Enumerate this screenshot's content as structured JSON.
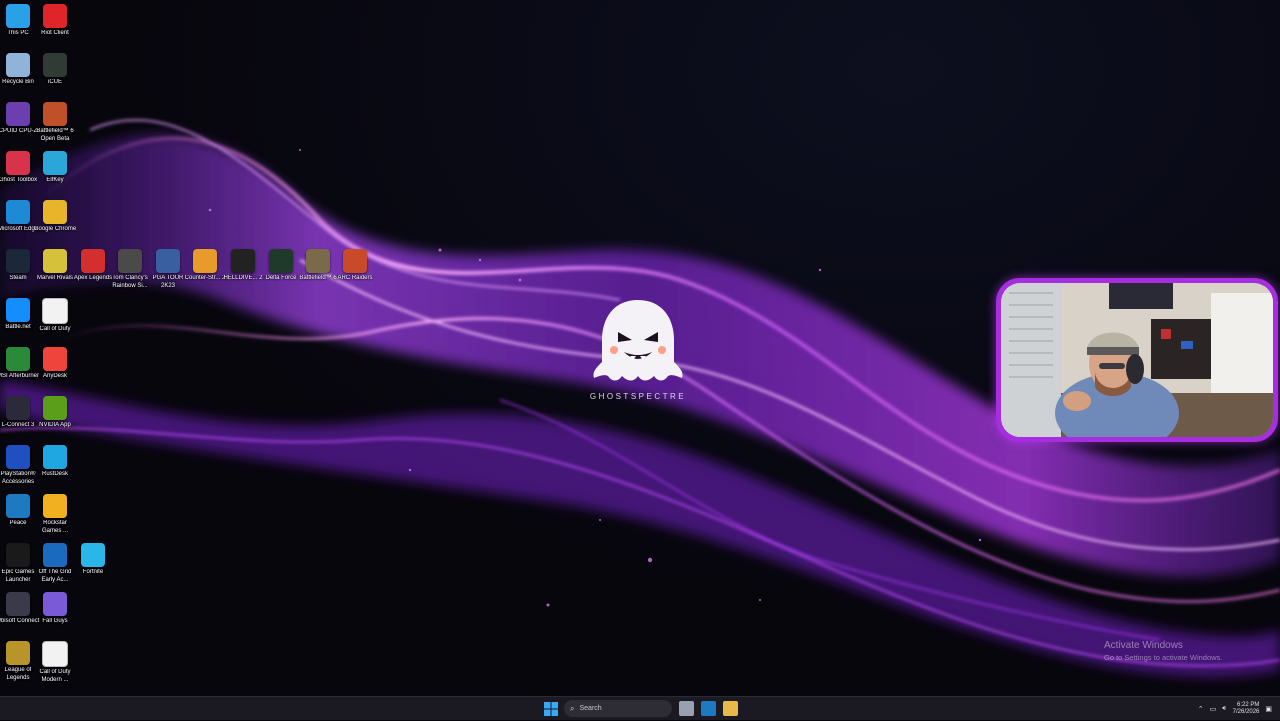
{
  "desktop_icons": [
    {
      "label": "This PC",
      "icon": "monitor-icon",
      "color": "#2aa0e8"
    },
    {
      "label": "Riot Client",
      "icon": "riot-client-icon",
      "color": "#e0252a"
    },
    {
      "label": "Recycle Bin",
      "icon": "recycle-bin-icon",
      "color": "#8fb3d9"
    },
    {
      "label": "iCUE",
      "icon": "icue-icon",
      "color": "#2f3b33"
    },
    {
      "label": "CPUID CPU-Z",
      "icon": "cpu-z-icon",
      "color": "#6b3fb0"
    },
    {
      "label": "Battlefield™ 6 Open Beta",
      "icon": "battlefield-icon",
      "color": "#c0502a"
    },
    {
      "label": "Ghost Toolbox",
      "icon": "ghost-toolbox-icon",
      "color": "#d9334b"
    },
    {
      "label": "EifKey",
      "icon": "eifkey-icon",
      "color": "#2aa6d9"
    },
    {
      "label": "Microsoft Edge",
      "icon": "edge-icon",
      "color": "#1e8ad6"
    },
    {
      "label": "Google Chrome",
      "icon": "chrome-icon",
      "color": "#e8b52a"
    },
    {
      "label": "Steam",
      "icon": "steam-icon",
      "color": "#1b2838"
    },
    {
      "label": "Marvel Rivals",
      "icon": "marvel-rivals-icon",
      "color": "#d6c13a"
    },
    {
      "label": "Apex Legends",
      "icon": "apex-legends-icon",
      "color": "#d32f2f"
    },
    {
      "label": "Tom Clancy's Rainbow Si...",
      "icon": "rainbow-six-icon",
      "color": "#4a4a4a"
    },
    {
      "label": "PGA TOUR 2K23",
      "icon": "pga-tour-icon",
      "color": "#3a5fa0"
    },
    {
      "label": "Counter-Str... 2",
      "icon": "counter-strike-icon",
      "color": "#e89a2a"
    },
    {
      "label": "HELLDIVE... 2",
      "icon": "helldivers-icon",
      "color": "#222222"
    },
    {
      "label": "Delta Force",
      "icon": "delta-force-icon",
      "color": "#1f3a2a"
    },
    {
      "label": "Battlefield™ 6",
      "icon": "battlefield-6-icon",
      "color": "#7a6a4a"
    },
    {
      "label": "ARC Raiders",
      "icon": "arc-raiders-icon",
      "color": "#c94a2a"
    },
    {
      "label": "Battle.net",
      "icon": "battlenet-icon",
      "color": "#148eff"
    },
    {
      "label": "Call of Duty",
      "icon": "file-icon",
      "color": "#f2f2f2"
    },
    {
      "label": "MSI Afterburner",
      "icon": "msi-afterburner-icon",
      "color": "#2a8a3a"
    },
    {
      "label": "AnyDesk",
      "icon": "anydesk-icon",
      "color": "#ef443b"
    },
    {
      "label": "L-Connect 3",
      "icon": "l-connect-icon",
      "color": "#2a2a3a"
    },
    {
      "label": "NVIDIA App",
      "icon": "nvidia-icon",
      "color": "#5a9e1a"
    },
    {
      "label": "PlayStation® Accessories",
      "icon": "playstation-icon",
      "color": "#1f4fc0"
    },
    {
      "label": "RustDesk",
      "icon": "rustdesk-icon",
      "color": "#1ea7e0"
    },
    {
      "label": "Peace",
      "icon": "peace-icon",
      "color": "#1e7ac0"
    },
    {
      "label": "Rockstar Games ...",
      "icon": "rockstar-icon",
      "color": "#f0b020"
    },
    {
      "label": "Epic Games Launcher",
      "icon": "epic-games-icon",
      "color": "#1a1a1a"
    },
    {
      "label": "Off The Grid Early Ac...",
      "icon": "off-the-grid-icon",
      "color": "#1a6ac0"
    },
    {
      "label": "Fortnite",
      "icon": "fortnite-icon",
      "color": "#2ab6e8"
    },
    {
      "label": "Ubisoft Connect",
      "icon": "ubisoft-icon",
      "color": "#3a3a4a"
    },
    {
      "label": "Fall Guys",
      "icon": "fall-guys-icon",
      "color": "#7a5ad6"
    },
    {
      "label": "League of Legends",
      "icon": "league-icon",
      "color": "#b8952a"
    },
    {
      "label": "Call of Duty Modern ...",
      "icon": "file-icon",
      "color": "#f2f2f2"
    }
  ],
  "logo": {
    "brand": "GHOSTSPECTRE"
  },
  "watermark": {
    "title": "Activate Windows",
    "subtitle": "Go to Settings to activate Windows."
  },
  "taskbar": {
    "search_placeholder": "Search",
    "apps": [
      {
        "icon": "task-view-icon",
        "color": "#9aa0b0"
      },
      {
        "icon": "peace-icon",
        "color": "#1e7ac0"
      },
      {
        "icon": "file-explorer-icon",
        "color": "#e8b84a"
      }
    ],
    "clock_time": "6:22 PM",
    "clock_date": "7/26/2026"
  },
  "colors": {
    "accent": "#a62ee0",
    "taskbar": "#1b1a22"
  }
}
